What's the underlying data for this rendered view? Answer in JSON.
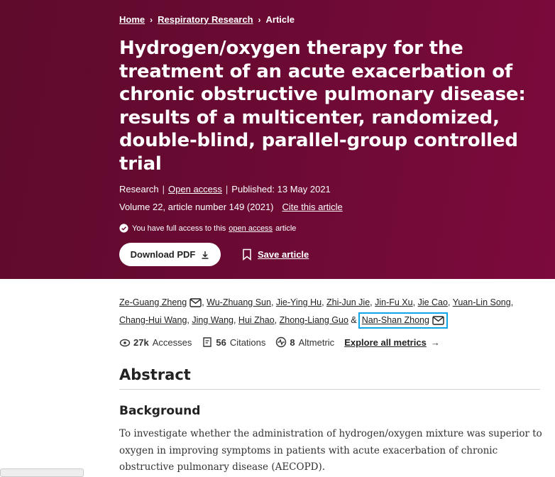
{
  "breadcrumb": [
    {
      "label": "Home",
      "link": true
    },
    {
      "label": "Respiratory Research",
      "link": true
    },
    {
      "label": "Article",
      "link": false
    }
  ],
  "article": {
    "title": "Hydrogen/oxygen therapy for the treatment of an acute exacerbation of chronic obstructive pulmonary disease: results of a multicenter, randomized, double-blind, parallel-group controlled trial",
    "type": "Research",
    "open_access": "Open access",
    "published": "Published: 13 May 2021",
    "volume": "Volume 22, article number 149 (2021)",
    "cite_label": "Cite this article"
  },
  "access_note": {
    "prefix": "You have full access to this",
    "link": "open access",
    "suffix": "article"
  },
  "actions": {
    "download_pdf": "Download PDF",
    "save_article": "Save article"
  },
  "authors": {
    "line1": [
      "Ze-Guang Zheng",
      "Wu-Zhuang Sun",
      "Jie-Ying Hu",
      "Zhi-Jun Jie",
      "Jin-Fu Xu",
      "Jie Cao",
      "Yuan-Lin Song"
    ],
    "line2": [
      "Chang-Hui Wang",
      "Jing Wang",
      "Hui Zhao",
      "Zhong-Liang Guo"
    ],
    "ampersand": "&",
    "last": "Nan-Shan Zhong"
  },
  "metrics": {
    "accesses_count": "27k",
    "accesses_label": "Accesses",
    "citations_count": "56",
    "citations_label": "Citations",
    "altmetric_count": "8",
    "altmetric_label": "Altmetric",
    "explore": "Explore all metrics"
  },
  "abstract": {
    "heading": "Abstract",
    "subheading": "Background",
    "text": "To investigate whether the administration of hydrogen/oxygen mixture was superior to oxygen in improving symptoms in patients with acute exacerbation of chronic obstructive pulmonary disease (AECOPD)."
  },
  "colors": {
    "hero_background": "#6a0a33",
    "highlight_border": "#0ea5e9"
  }
}
